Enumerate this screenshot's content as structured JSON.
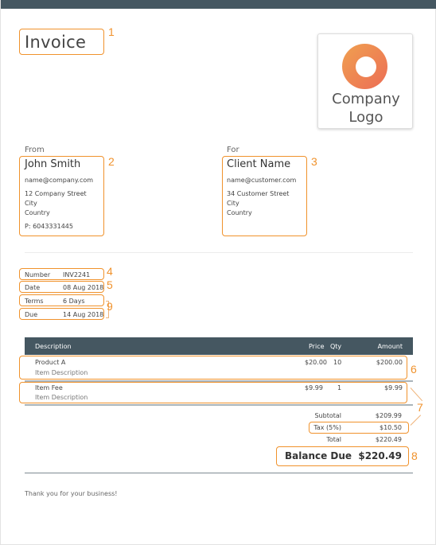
{
  "header": {
    "title": "Invoice",
    "logo_line1": "Company",
    "logo_line2": "Logo"
  },
  "from": {
    "label": "From",
    "name": "John Smith",
    "email": "name@company.com",
    "street": "12 Company Street",
    "city": "City",
    "country": "Country",
    "phone": "P: 6043331445"
  },
  "to": {
    "label": "For",
    "name": "Client Name",
    "email": "name@customer.com",
    "street": "34 Customer Street",
    "city": "City",
    "country": "Country"
  },
  "meta": {
    "number_label": "Number",
    "number_value": "INV2241",
    "date_label": "Date",
    "date_value": "08 Aug 2018",
    "terms_label": "Terms",
    "terms_value": "6 Days",
    "due_label": "Due",
    "due_value": "14 Aug 2018"
  },
  "table": {
    "headers": {
      "description": "Description",
      "price": "Price",
      "qty": "Qty",
      "amount": "Amount"
    },
    "rows": [
      {
        "name": "Product A",
        "description": "Item Description",
        "price": "$20.00",
        "qty": "10",
        "amount": "$200.00"
      },
      {
        "name": "Item Fee",
        "description": "Item Description",
        "price": "$9.99",
        "qty": "1",
        "amount": "$9.99"
      }
    ]
  },
  "totals": {
    "subtotal_label": "Subtotal",
    "subtotal_value": "$209.99",
    "tax_label": "Tax (5%)",
    "tax_value": "$10.50",
    "total_label": "Total",
    "total_value": "$220.49",
    "balance_label": "Balance Due",
    "balance_value": "$220.49"
  },
  "footer": {
    "note": "Thank you for your business!"
  },
  "annotations": {
    "n1": "1",
    "n2": "2",
    "n3": "3",
    "n4": "4",
    "n5": "5",
    "n6": "6",
    "n7": "7",
    "n8": "8",
    "n9": "9"
  },
  "colors": {
    "accent": "#f0922c",
    "header_bar": "#455761",
    "logo_gradient_start": "#f0a050",
    "logo_gradient_end": "#ec6d55"
  }
}
